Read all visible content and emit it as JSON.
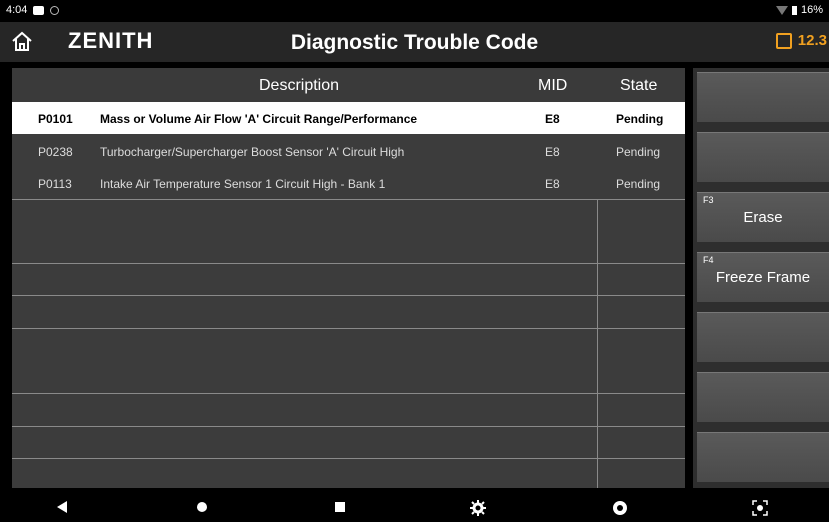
{
  "status_bar": {
    "time": "4:04",
    "battery_percent": "16%"
  },
  "header": {
    "logo": "ZENITH",
    "title": "Diagnostic Trouble Code",
    "voltage": "12.3"
  },
  "table": {
    "headers": {
      "description": "Description",
      "mid": "MID",
      "state": "State"
    },
    "rows": [
      {
        "code": "P0101",
        "description": "Mass or Volume Air Flow 'A' Circuit Range/Performance",
        "mid": "E8",
        "state": "Pending"
      },
      {
        "code": "P0238",
        "description": "Turbocharger/Supercharger Boost Sensor 'A' Circuit High",
        "mid": "E8",
        "state": "Pending"
      },
      {
        "code": "P0113",
        "description": "Intake Air Temperature Sensor 1 Circuit High - Bank 1",
        "mid": "E8",
        "state": "Pending"
      }
    ]
  },
  "sidebar": {
    "f3": {
      "key": "F3",
      "label": "Erase"
    },
    "f4": {
      "key": "F4",
      "label": "Freeze Frame"
    }
  },
  "nav_icons": [
    "back-icon",
    "home-dot-icon",
    "recents-icon",
    "settings-icon",
    "browser-icon",
    "screenshot-icon"
  ]
}
